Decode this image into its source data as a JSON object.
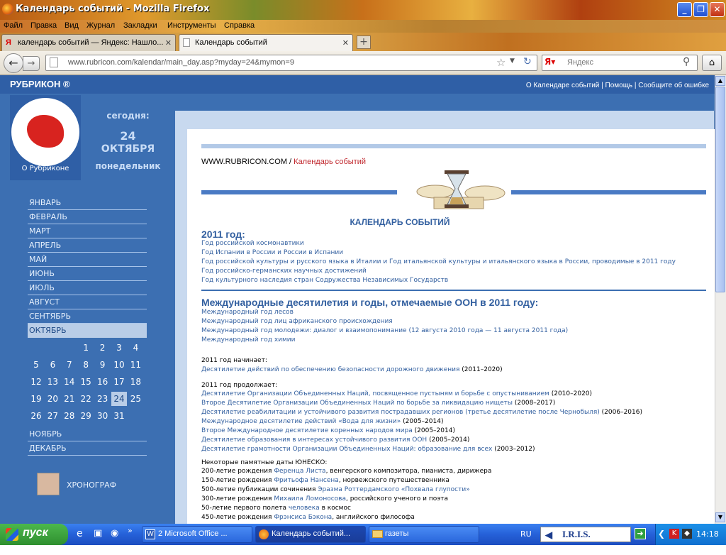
{
  "window": {
    "title": "Календарь событий - Mozilla Firefox"
  },
  "menu": [
    "Файл",
    "Правка",
    "Вид",
    "Журнал",
    "Закладки",
    "Инструменты",
    "Справка"
  ],
  "tabs": [
    {
      "label": "календарь событий — Яндекс: Нашло..."
    },
    {
      "label": "Календарь событий"
    }
  ],
  "url": "www.rubricon.com/kalendar/main_day.asp?myday=24&mymon=9",
  "search": {
    "placeholder": "Яндекс"
  },
  "site": {
    "brand": "РУБРИКОН ®",
    "links": "О Календаре событий | Помощь | Сообщите об ошибке",
    "about": "О Рубриконе"
  },
  "today": {
    "label": "сегодня:",
    "day": "24",
    "month": "ОКТЯБРЯ",
    "weekday": "понедельник"
  },
  "months_before": [
    "ЯНВАРЬ",
    "ФЕВРАЛЬ",
    "МАРТ",
    "АПРЕЛЬ",
    "МАЙ",
    "ИЮНЬ",
    "ИЮЛЬ",
    "АВГУСТ",
    "СЕНТЯБРЬ",
    "ОКТЯБРЬ"
  ],
  "months_after": [
    "НОЯБРЬ",
    "ДЕКАБРЬ"
  ],
  "calendar": {
    "days": [
      "1",
      "2",
      "3",
      "4",
      "5",
      "6",
      "7",
      "8",
      "9",
      "10",
      "11",
      "12",
      "13",
      "14",
      "15",
      "16",
      "17",
      "18",
      "19",
      "20",
      "21",
      "22",
      "23",
      "24",
      "25",
      "26",
      "27",
      "28",
      "29",
      "30",
      "31"
    ],
    "selected": "24"
  },
  "chrono": "ХРОНОГРАФ",
  "crumb": {
    "site": "WWW.RUBRICON.COM",
    "sep": " / ",
    "current": "Календарь событий"
  },
  "cal_title": "КАЛЕНДАРЬ СОБЫТИЙ",
  "year_heading": "2011 год:",
  "year_items": [
    "Год российской космонавтики",
    "Год Испании в России и России в Испании",
    "Год российской культуры и русского языка в Италии и Год итальянской культуры и итальянского языка в России, проводимые в 2011 году",
    "Год российско-германских научных достижений",
    "Год культурного наследия стран Содружества Независимых Государств"
  ],
  "un_heading": "Международные десятилетия и годы, отмечаемые ООН в 2011 году:",
  "un_items": [
    "Международный год лесов",
    "Международный год лиц африканского происхождения",
    "Международный год молодежи: диалог и взаимопонимание (12 августа 2010 года — 11 августа 2011 года)",
    "Международный год химии"
  ],
  "begins_label": "2011 год начинает:",
  "begins_items": [
    {
      "link": "Десятилетие действий по обеспечению безопасности дорожного движения",
      "tail": " (2011–2020)"
    }
  ],
  "continues_label": "2011 год продолжает:",
  "continues_items": [
    {
      "link": "Десятилетие Организации Объединенных Наций, посвященное пустыням и борьбе с опустыниванием",
      "tail": " (2010–2020)"
    },
    {
      "link": "Второе Десятилетие Организации Объединенных Наций по борьбе за ликвидацию нищеты",
      "tail": " (2008–2017)"
    },
    {
      "link": "Десятилетие реабилитации и устойчивого развития пострадавших регионов (третье десятилетие после Чернобыля)",
      "tail": " (2006–2016)"
    },
    {
      "link": "Международное десятилетие действий «Вода для жизни»",
      "tail": " (2005–2014)"
    },
    {
      "link": "Второе Международное десятилетие коренных народов мира",
      "tail": " (2005–2014)"
    },
    {
      "link": "Десятилетие образования в интересах устойчивого развития ООН",
      "tail": " (2005–2014)"
    },
    {
      "link": "Десятилетие грамотности Организации Объединенных Наций: образование для всех",
      "tail": " (2003–2012)"
    }
  ],
  "unesco_label": "Некоторые памятные даты ЮНЕСКО:",
  "unesco_items": [
    {
      "pre": "200-летие рождения ",
      "link": "Ференца Листа",
      "tail": ", венгерского композитора, пианиста, дирижера"
    },
    {
      "pre": "150-летие рождения ",
      "link": "Фритьофа Нансена",
      "tail": ", норвежского путешественника"
    },
    {
      "pre": "500-летие публикации сочинения ",
      "link": "Эразма Роттердамского «Похвала глупости»",
      "tail": ""
    },
    {
      "pre": "300-летие рождения ",
      "link": "Михаила Ломоносова",
      "tail": ", российского ученого и поэта"
    },
    {
      "pre": "50-летие первого полета ",
      "link": "человека",
      "tail": " в космос"
    },
    {
      "pre": "450-летие рождения ",
      "link": "Фрэнсиса Бэкона",
      "tail": ", английского философа"
    }
  ],
  "taskbar": {
    "start": "пуск",
    "buttons": [
      "2 Microsoft Office ...",
      "Календарь событий...",
      "газеты"
    ],
    "lang": "RU",
    "iris": "I.R.I.S.",
    "clock": "14:18"
  }
}
